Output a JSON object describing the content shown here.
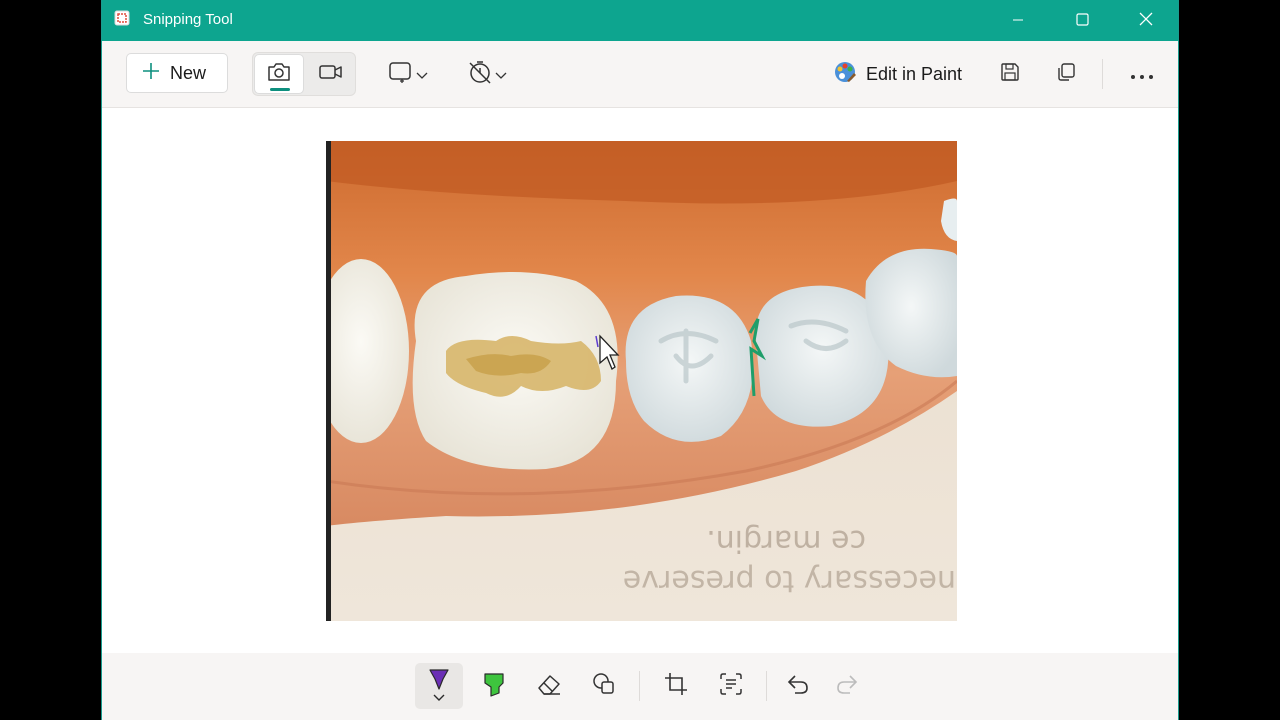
{
  "window": {
    "title": "Snipping Tool"
  },
  "toolbar": {
    "new_label": "New",
    "edit_in_paint_label": "Edit in Paint"
  },
  "icons": {
    "titlebar": [
      "snipping-tool-icon",
      "minimize-icon",
      "maximize-icon",
      "close-icon"
    ],
    "toolbar": [
      "plus-icon",
      "camera-icon",
      "video-icon",
      "snip-rectangle-icon",
      "chevron-down-icon",
      "timer-off-icon",
      "paint-palette-icon",
      "save-icon",
      "copy-icon",
      "more-icon"
    ],
    "bottom": [
      "ballpoint-pen-icon",
      "highlighter-icon",
      "eraser-icon",
      "shapes-icon",
      "crop-icon",
      "text-actions-icon",
      "undo-icon",
      "redo-icon"
    ]
  },
  "colors": {
    "accent": "#0da58f",
    "pen": "#6b2fb5",
    "highlighter": "#3ec43e"
  },
  "captured_image": {
    "subject": "dental model photo"
  }
}
